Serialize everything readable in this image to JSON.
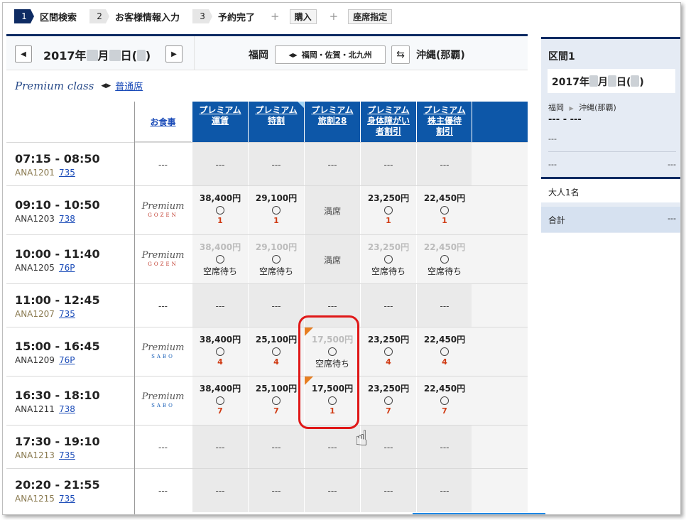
{
  "steps": [
    {
      "num": "1",
      "label": "区間検索"
    },
    {
      "num": "2",
      "label": "お客様情報入力"
    },
    {
      "num": "3",
      "label": "予約完了"
    }
  ],
  "extra_steps": [
    "購入",
    "座席指定"
  ],
  "plus": "+",
  "date_label": "2017年",
  "date_month": "月",
  "date_day": "日(",
  "date_close": ")",
  "origin": "福岡",
  "airport_selector": "福岡・佐賀・北九州",
  "destination": "沖縄(那覇)",
  "class": {
    "premium": "Premium class",
    "economy_link": "普通席"
  },
  "meal_header": "お食事",
  "fare_headers": [
    "プレミアム運賃",
    "プレミアム特割",
    "プレミアム旅割28",
    "プレミアム身体障がい者割引",
    "プレミアム株主優待割引"
  ],
  "fare_header_lines": [
    [
      "プレミアム",
      "運賃"
    ],
    [
      "プレミアム",
      "特割"
    ],
    [
      "プレミアム",
      "旅割28"
    ],
    [
      "プレミアム",
      "身体障がい",
      "者割引"
    ],
    [
      "プレミアム",
      "株主優待",
      "割引"
    ]
  ],
  "flights": [
    {
      "time": "07:15 - 08:50",
      "flight": "ANA1201",
      "aircraft": "735",
      "meal": "---",
      "meal_logo": "",
      "fares": [
        {
          "t": "dash",
          "text": "---"
        },
        {
          "t": "dash",
          "text": "---"
        },
        {
          "t": "dash",
          "text": "---"
        },
        {
          "t": "dash",
          "text": "---"
        },
        {
          "t": "dash",
          "text": "---"
        }
      ]
    },
    {
      "time": "09:10 - 10:50",
      "flight": "ANA1203",
      "aircraft": "738",
      "meal": "",
      "meal_logo": "GOZEN",
      "fares": [
        {
          "t": "avail",
          "price": "38,400円",
          "seats": "1"
        },
        {
          "t": "avail",
          "price": "29,100円",
          "seats": "1"
        },
        {
          "t": "full",
          "text": "満席"
        },
        {
          "t": "avail",
          "price": "23,250円",
          "seats": "1"
        },
        {
          "t": "avail",
          "price": "22,450円",
          "seats": "1"
        }
      ]
    },
    {
      "time": "10:00 - 11:40",
      "flight": "ANA1205",
      "aircraft": "76P",
      "meal": "",
      "meal_logo": "GOZEN",
      "fares": [
        {
          "t": "wait",
          "price": "38,400円",
          "text": "空席待ち"
        },
        {
          "t": "wait",
          "price": "29,100円",
          "text": "空席待ち"
        },
        {
          "t": "full",
          "text": "満席"
        },
        {
          "t": "wait",
          "price": "23,250円",
          "text": "空席待ち"
        },
        {
          "t": "wait",
          "price": "22,450円",
          "text": "空席待ち"
        }
      ]
    },
    {
      "time": "11:00 - 12:45",
      "flight": "ANA1207",
      "aircraft": "735",
      "meal": "---",
      "meal_logo": "",
      "fares": [
        {
          "t": "dash",
          "text": "---"
        },
        {
          "t": "dash",
          "text": "---"
        },
        {
          "t": "dash",
          "text": "---"
        },
        {
          "t": "dash",
          "text": "---"
        },
        {
          "t": "dash",
          "text": "---"
        }
      ]
    },
    {
      "time": "15:00 - 16:45",
      "flight": "ANA1209",
      "aircraft": "76P",
      "meal": "",
      "meal_logo": "SABO",
      "fares": [
        {
          "t": "avail",
          "price": "38,400円",
          "seats": "4"
        },
        {
          "t": "avail",
          "price": "25,100円",
          "seats": "4"
        },
        {
          "t": "wait",
          "price": "17,500円",
          "text": "空席待ち",
          "corner": true
        },
        {
          "t": "avail",
          "price": "23,250円",
          "seats": "4"
        },
        {
          "t": "avail",
          "price": "22,450円",
          "seats": "4"
        }
      ]
    },
    {
      "time": "16:30 - 18:10",
      "flight": "ANA1211",
      "aircraft": "738",
      "meal": "",
      "meal_logo": "SABO",
      "fares": [
        {
          "t": "avail",
          "price": "38,400円",
          "seats": "7"
        },
        {
          "t": "avail",
          "price": "25,100円",
          "seats": "7"
        },
        {
          "t": "avail",
          "price": "17,500円",
          "seats": "1",
          "corner": true
        },
        {
          "t": "avail",
          "price": "23,250円",
          "seats": "7"
        },
        {
          "t": "avail",
          "price": "22,450円",
          "seats": "7"
        }
      ]
    },
    {
      "time": "17:30 - 19:10",
      "flight": "ANA1213",
      "aircraft": "735",
      "meal": "---",
      "meal_logo": "",
      "fares": [
        {
          "t": "dash",
          "text": "---"
        },
        {
          "t": "dash",
          "text": "---"
        },
        {
          "t": "dash",
          "text": "---"
        },
        {
          "t": "dash",
          "text": "---"
        },
        {
          "t": "dash",
          "text": "---"
        }
      ]
    },
    {
      "time": "20:20 - 21:55",
      "flight": "ANA1215",
      "aircraft": "735",
      "meal": "---",
      "meal_logo": "",
      "fares": [
        {
          "t": "dash",
          "text": "---"
        },
        {
          "t": "dash",
          "text": "---"
        },
        {
          "t": "dash",
          "text": "---"
        },
        {
          "t": "dash",
          "text": "---"
        },
        {
          "t": "dash",
          "text": "---"
        }
      ]
    }
  ],
  "meal_logo_text": "Premium",
  "side": {
    "title": "区間1",
    "date": "2017年",
    "date_month": "月",
    "date_day": "日(",
    "date_close": ")",
    "route_from": "福岡",
    "route_to": "沖縄(那覇)",
    "time": "--- - ---",
    "dash": "---",
    "row_left": "---",
    "row_right": "---",
    "passengers": "大人1名",
    "total_label": "合計",
    "total_value": "---"
  },
  "colors": {
    "navy": "#0e2b63",
    "header_blue": "#0d57a8",
    "seat_red": "#d03b14",
    "highlight": "#e01818"
  }
}
